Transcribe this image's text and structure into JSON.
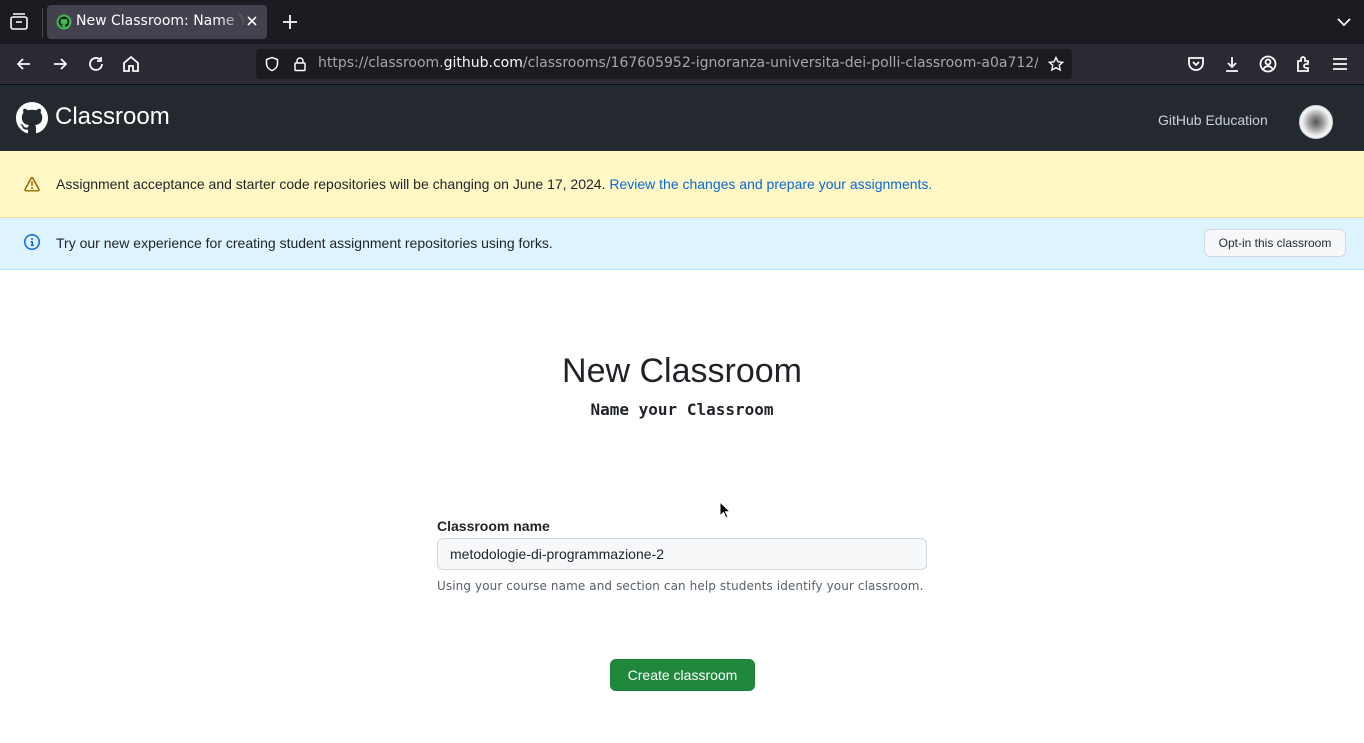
{
  "browser": {
    "tab_title": "New Classroom: Name Your Classroom",
    "url_scheme": "https://",
    "url_host_prefix": "classroom.",
    "url_host": "github.com",
    "url_path": "/classrooms/167605952-ignoranza-universita-dei-polli-classroom-a0a712/"
  },
  "header": {
    "brand": "Classroom",
    "education_link": "GitHub Education"
  },
  "banners": {
    "warning_text": "Assignment acceptance and starter code repositories will be changing on June 17, 2024.",
    "warning_link": "Review the changes and prepare your assignments.",
    "info_text": "Try our new experience for creating student assignment repositories using forks.",
    "optin_label": "Opt-in this classroom"
  },
  "main": {
    "title": "New Classroom",
    "subtitle": "Name your Classroom",
    "field_label": "Classroom name",
    "field_value": "metodologie-di-programmazione-2",
    "field_hint": "Using your course name and section can help students identify your classroom.",
    "submit_label": "Create classroom"
  },
  "colors": {
    "header_bg": "#24292f",
    "warning_bg": "#fff8c5",
    "info_bg": "#ddf4ff",
    "primary_button": "#1f883d",
    "link": "#0969da"
  }
}
